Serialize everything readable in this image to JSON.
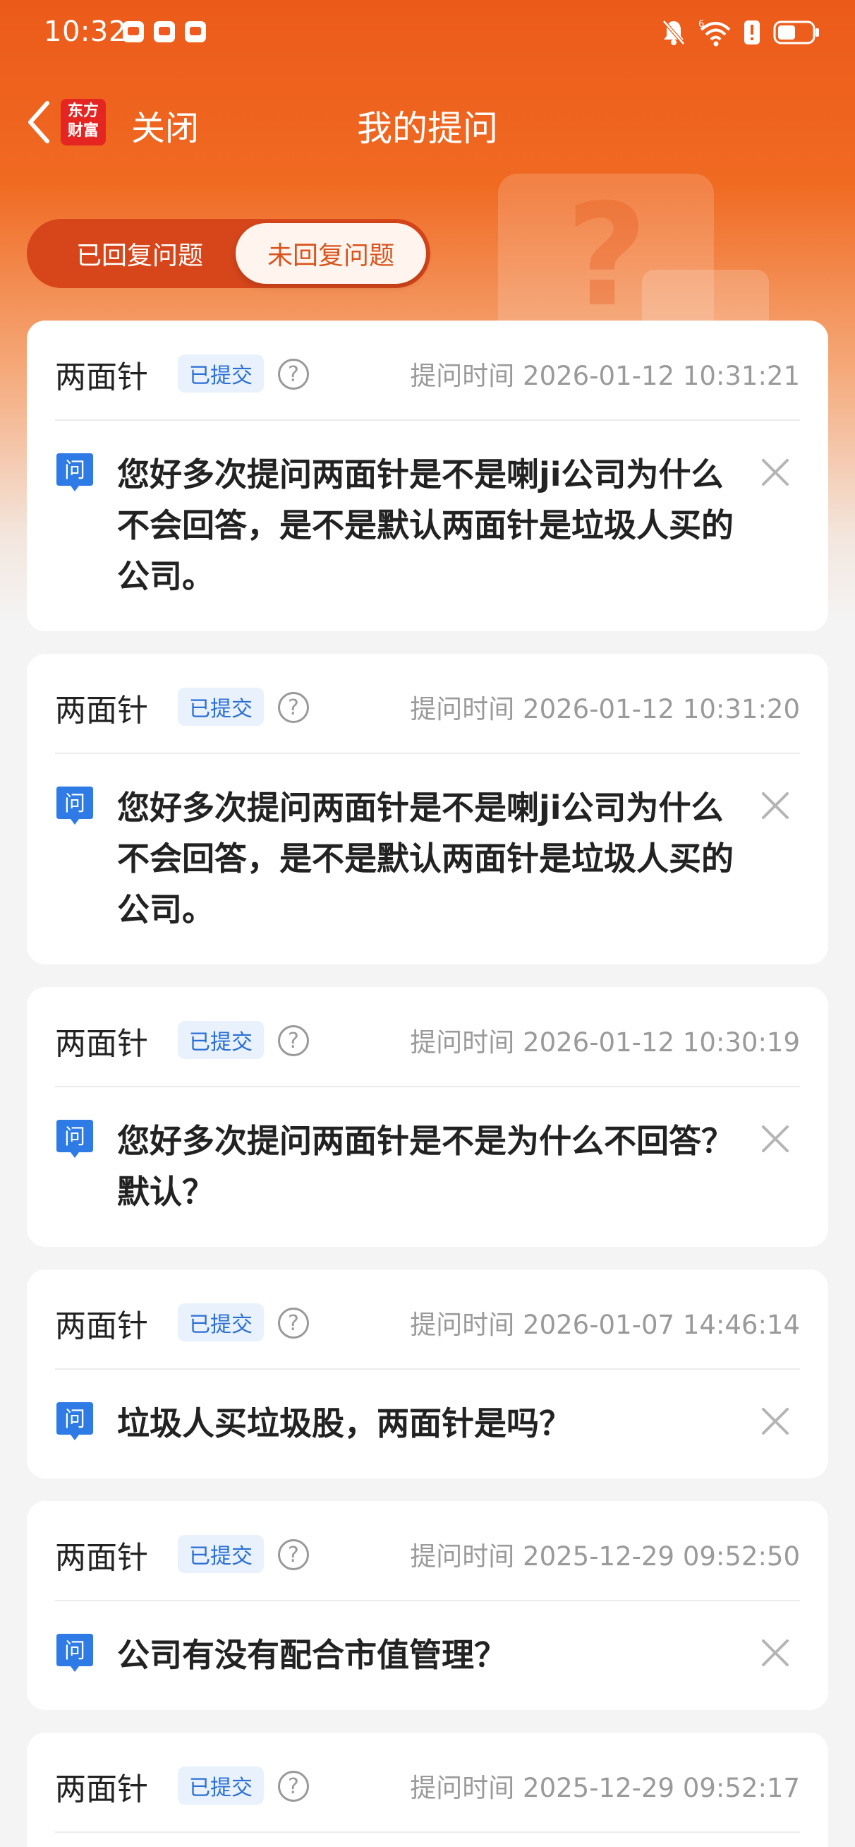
{
  "status": {
    "time": "10:32",
    "network": "6"
  },
  "header": {
    "logo_line1": "东方",
    "logo_line2": "财富",
    "close_label": "关闭",
    "title": "我的提问"
  },
  "tabs": {
    "answered": "已回复问题",
    "unanswered": "未回复问题",
    "active": "unanswered"
  },
  "questions": [
    {
      "company": "两面针",
      "status": "已提交",
      "time_label": "提问时间 2026-01-12 10:31:21",
      "text": "您好多次提问两面针是不是喇ji公司为什么不会回答，是不是默认两面针是垃圾人买的公司。"
    },
    {
      "company": "两面针",
      "status": "已提交",
      "time_label": "提问时间 2026-01-12 10:31:20",
      "text": "您好多次提问两面针是不是喇ji公司为什么不会回答，是不是默认两面针是垃圾人买的公司。"
    },
    {
      "company": "两面针",
      "status": "已提交",
      "time_label": "提问时间 2026-01-12 10:30:19",
      "text": "您好多次提问两面针是不是为什么不回答？默认？"
    },
    {
      "company": "两面针",
      "status": "已提交",
      "time_label": "提问时间 2026-01-07 14:46:14",
      "text": "垃圾人买垃圾股，两面针是吗？"
    },
    {
      "company": "两面针",
      "status": "已提交",
      "time_label": "提问时间 2025-12-29 09:52:50",
      "text": "公司有没有配合市值管理？"
    },
    {
      "company": "两面针",
      "status": "已提交",
      "time_label": "提问时间 2025-12-29 09:52:17",
      "text": ""
    }
  ],
  "icons": {
    "question_mark": "?",
    "ask_label": "问"
  },
  "colors": {
    "brand_orange": "#ec5a1a",
    "badge_blue": "#2a6fd6",
    "ask_icon_blue": "#2f7be6"
  }
}
